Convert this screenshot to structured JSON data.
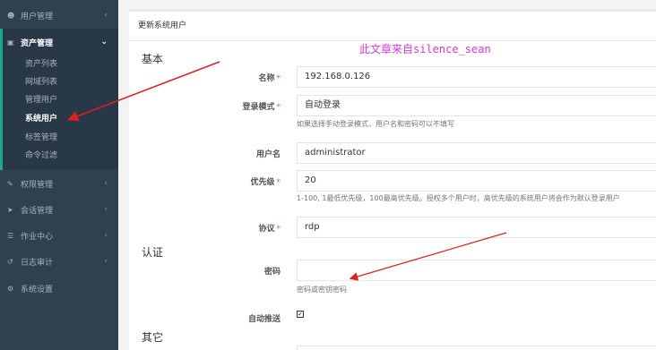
{
  "sidebar": {
    "menus": [
      {
        "label": "用户管理",
        "icon": "users-icon"
      },
      {
        "label": "资产管理",
        "icon": "inbox-icon"
      },
      {
        "label": "权限管理",
        "icon": "edit-icon"
      },
      {
        "label": "会话管理",
        "icon": "rocket-icon"
      },
      {
        "label": "作业中心",
        "icon": "list-icon"
      },
      {
        "label": "日志审计",
        "icon": "history-icon"
      },
      {
        "label": "系统设置",
        "icon": "cogs-icon"
      }
    ],
    "asset_submenu": [
      "资产列表",
      "网域列表",
      "管理用户",
      "系统用户",
      "标签管理",
      "命令过滤"
    ],
    "active_sub": "系统用户"
  },
  "panel": {
    "title": "更新系统用户"
  },
  "watermark": "此文章来自silence_sean",
  "form": {
    "section_basic": "基本",
    "section_auth": "认证",
    "section_other": "其它",
    "name_label": "名称",
    "name_value": "192.168.0.126",
    "login_mode_label": "登录模式",
    "login_mode_value": "自动登录",
    "login_mode_help": "如果选择手动登录模式，用户名和密码可以不填写",
    "username_label": "用户名",
    "username_value": "administrator",
    "priority_label": "优先级",
    "priority_value": "20",
    "priority_help": "1-100, 1最低优先级，100最高优先级。授权多个用户时，高优先级的系统用户将会作为默认登录用户",
    "protocol_label": "协议",
    "protocol_value": "rdp",
    "password_label": "密码",
    "password_value": "",
    "password_help": "密码或密钥密码",
    "auto_push_label": "自动推送",
    "auto_push_checked": true,
    "required_mark": "*"
  },
  "colors": {
    "sidebar_bg": "#2f4050",
    "accent": "#19aa8d",
    "required": "#ed5565",
    "annotation_arrow": "#e02020",
    "watermark": "#e033e0"
  }
}
